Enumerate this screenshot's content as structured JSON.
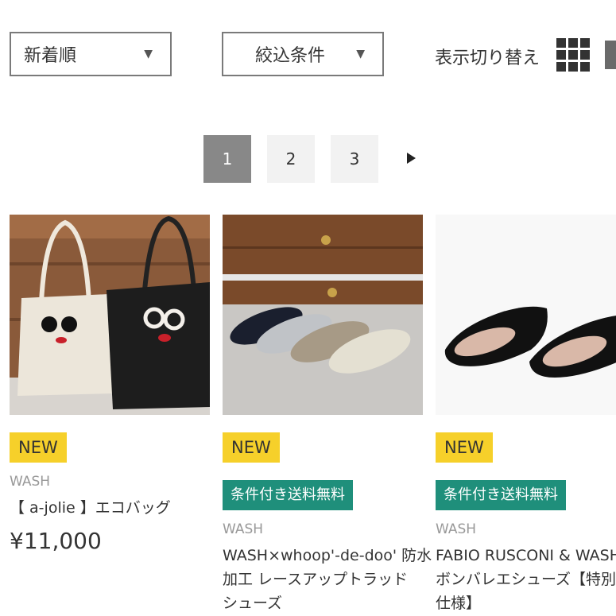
{
  "toolbar": {
    "sort_value": "新着順",
    "filter_label": "絞込条件",
    "view_toggle_label": "表示切り替え"
  },
  "pagination": {
    "pages": [
      "1",
      "2",
      "3"
    ],
    "current": "1"
  },
  "products": [
    {
      "badge_new": "NEW",
      "brand": "WASH",
      "name_lines": [
        "【 a-jolie 】エコバッグ"
      ],
      "price": "¥11,000"
    },
    {
      "badge_new": "NEW",
      "badge_shipping": "条件付き送料無料",
      "brand": "WASH",
      "name_lines": [
        "WASH×whoop'-de-doo' 防水",
        "加工 レースアップトラッド",
        "シューズ"
      ]
    },
    {
      "badge_new": "NEW",
      "badge_shipping": "条件付き送料無料",
      "brand": "WASH",
      "name_lines": [
        "FABIO RUSCONI & WASH",
        "ボンバレエシューズ【特別",
        "仕様】"
      ]
    }
  ],
  "colors": {
    "new_badge": "#f6d02a",
    "shipping_badge": "#1f8f7b",
    "active_page": "#888888"
  }
}
